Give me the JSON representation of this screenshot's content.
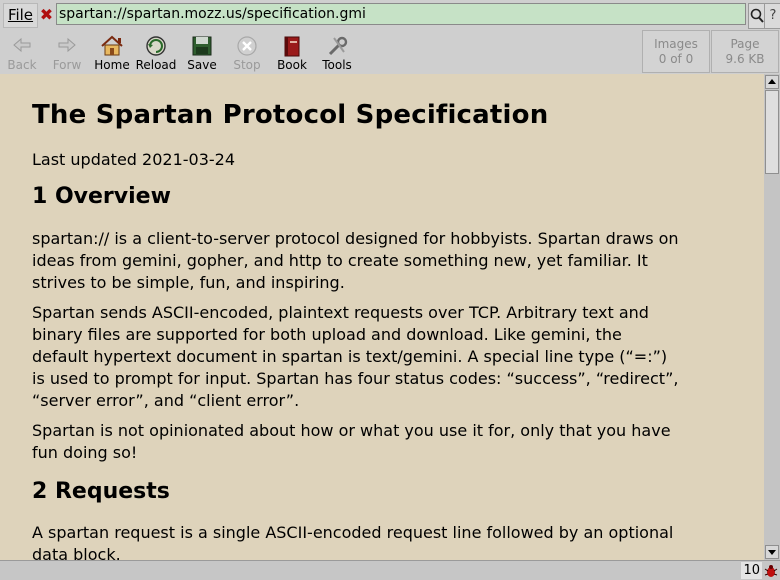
{
  "window": {
    "file_menu": "File",
    "url": "spartan://spartan.mozz.us/specification.gmi",
    "help_label": "?"
  },
  "toolbar": {
    "back": "Back",
    "forward": "Forw",
    "home": "Home",
    "reload": "Reload",
    "save": "Save",
    "stop": "Stop",
    "book": "Book",
    "tools": "Tools",
    "images_label": "Images",
    "images_value": "0 of 0",
    "page_label": "Page",
    "page_value": "9.6 KB"
  },
  "document": {
    "title": "The Spartan Protocol Specification",
    "updated": "Last updated 2021-03-24",
    "h_overview": "1 Overview",
    "p1": "spartan:// is a client-to-server protocol designed for hobbyists. Spartan draws on ideas from gemini, gopher, and http to create something new, yet familiar. It strives to be simple, fun, and inspiring.",
    "p2": "Spartan sends ASCII-encoded, plaintext requests over TCP. Arbitrary text and binary files are supported for both upload and download. Like gemini, the default hypertext document in spartan is text/gemini. A special line type (“=:”) is used to prompt for input. Spartan has four status codes: “success”, “redirect”, “server error”, and “client error”.",
    "p3": "Spartan is not opinionated about how or what you use it for, only that you have fun doing so!",
    "h_requests": "2 Requests",
    "p4": "A spartan request is a single ASCII-encoded request line followed by an optional data block."
  },
  "status": {
    "count": "10"
  },
  "colors": {
    "url_bg": "#c6e2c6",
    "page_bg": "#ded3bb",
    "chrome": "#cfcfcf"
  }
}
